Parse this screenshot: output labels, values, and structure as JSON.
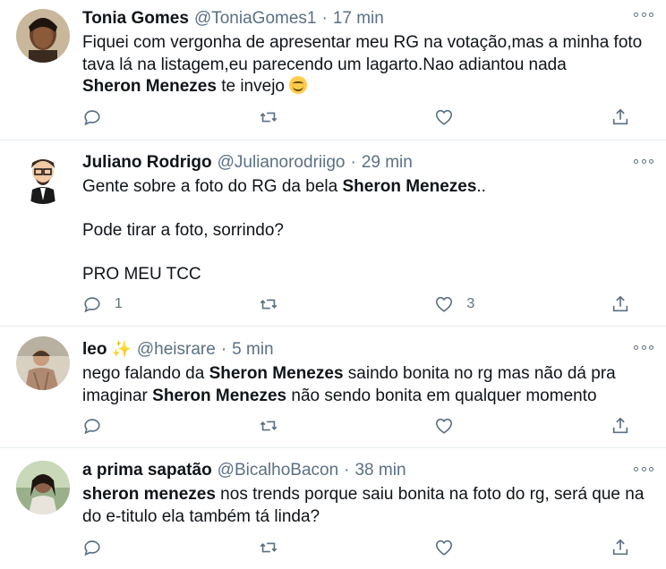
{
  "tweets": [
    {
      "name": "Tonia Gomes",
      "handle": "@ToniaGomes1",
      "dot": "·",
      "time": "17 min",
      "lines": [
        "Fiquei com vergonha de apresentar meu RG na votação,mas a minha foto",
        "tava lá na listagem,eu parecendo um lagarto.Nao adiantou nada",
        "Sheron Menezes",
        " te invejo "
      ],
      "replies": "",
      "retweets": "",
      "likes": ""
    },
    {
      "name": "Juliano Rodrigo",
      "handle": "@Julianorodriigo",
      "dot": "·",
      "time": "29 min",
      "lines": [
        "Gente sobre a foto do RG da bela ",
        "Sheron Menezes",
        "..",
        "Pode tirar a foto, sorrindo?",
        "PRO MEU TCC"
      ],
      "replies": "1",
      "retweets": "",
      "likes": "3"
    },
    {
      "name": "leo",
      "handle": "@heisrare",
      "dot": "·",
      "time": "5 min",
      "lines": [
        "nego falando da ",
        "Sheron Menezes",
        " saindo bonita no rg mas não dá pra",
        "imaginar ",
        "Sheron Menezes",
        " não sendo bonita em qualquer momento"
      ],
      "replies": "",
      "retweets": "",
      "likes": ""
    },
    {
      "name": "a prima sapatão",
      "handle": "@BicalhoBacon",
      "dot": "·",
      "time": "38 min",
      "lines": [
        "sheron menezes",
        " nos trends porque saiu bonita na foto do rg, será que na",
        "do e-titulo ela também tá linda?"
      ],
      "replies": "",
      "retweets": "",
      "likes": ""
    }
  ],
  "icons": {
    "reply": "reply-icon",
    "retweet": "retweet-icon",
    "like": "heart-icon",
    "share": "share-icon",
    "more": "more-options-icon",
    "sparkle": "sparkles-icon",
    "emoji": "smiling-face-icon"
  },
  "colors": {
    "text": "#0f1419",
    "secondary": "#5b7083",
    "divider": "#e6ecf0"
  }
}
